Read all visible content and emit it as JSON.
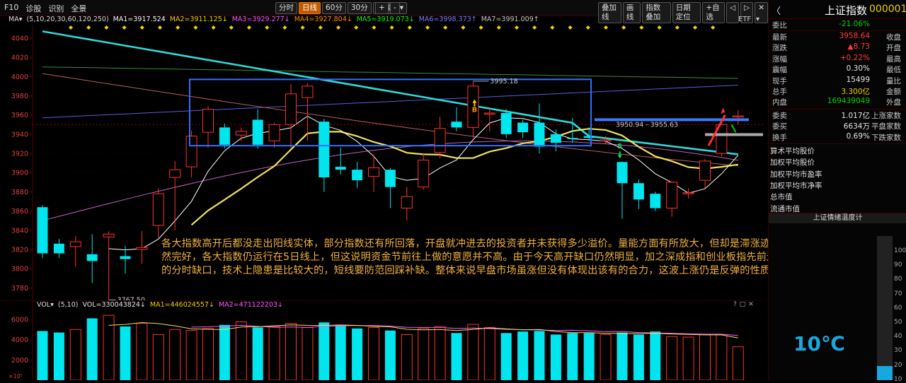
{
  "toolbar": {
    "left_items": [
      "F10",
      "诊股",
      "识别",
      "全景"
    ],
    "periods": [
      "分时",
      "日线",
      "60分",
      "30分",
      "周线"
    ],
    "active_period": "日线",
    "period_more": "▾",
    "plus": "+",
    "minus": "-",
    "right_items": [
      "叠加线",
      "画线",
      "指数叠加",
      "日期定位",
      "+自选"
    ],
    "window_icons": [
      "◁",
      "▷",
      "✕"
    ]
  },
  "ma_legend": {
    "label": "MA▾",
    "params": "(5,10,20,30,60,120,250)",
    "items": [
      {
        "text": "MA1=3917.524",
        "color": "#ffffff"
      },
      {
        "text": "MA2=3911.125↓",
        "color": "#f0d000"
      },
      {
        "text": "MA3=3929.277↓",
        "color": "#ff55ff"
      },
      {
        "text": "MA4=3927.804↓",
        "color": "#ff8c00"
      },
      {
        "text": "MA5=3919.073↓",
        "color": "#00ff00"
      },
      {
        "text": "MA6=3998.373↑",
        "color": "#7b7bff"
      },
      {
        "text": "MA7=3991.009↑",
        "color": "#c8c8c8"
      }
    ],
    "etf": "ETF",
    "etf_arrow": "▾"
  },
  "main_axis": {
    "ticks": [
      "4040",
      "4020",
      "4000",
      "3980",
      "3960",
      "3940",
      "3920",
      "3900",
      "3880",
      "3860",
      "3840",
      "3820",
      "3800",
      "3780"
    ]
  },
  "annotations": {
    "high_price": "3995.18",
    "low_price": "3767.50",
    "gap_range": "3950.94 - 3955.63",
    "buy_marker": "B",
    "sell_marker": "S"
  },
  "note_text": "各大指数高开后都没走出阳线实体，部分指数还有所回落，开盘就冲进去的投资者并未获得多少溢价。量能方面有所放大，但却是滞涨迹象。虽然反弹趋势仍然完好，各大指数仍运行在5日线上，但这说明资金节前往上做的意愿并不高。由于今天高开缺口仍然明显，加之深成指和创业板指先前还有留有两个未补完的分时缺口，技术上隐患是比较大的，短线要防范回踩补缺。整体来说早盘市场虽涨但没有体现出该有的合力，这波上涨仍是反弹的性质不变。",
  "vol_legend": {
    "label": "VOL▾",
    "params": "(5,10)",
    "items": [
      {
        "text": "VOL=330043824↓",
        "color": "#e6e6e6"
      },
      {
        "text": "MA1=446024557↓",
        "color": "#f0d000"
      },
      {
        "text": "MA2=471122203↓",
        "color": "#ff55ff"
      }
    ],
    "axis": [
      "6000",
      "4000",
      "2000"
    ],
    "unit": "×10⁵",
    "icons": [
      "?",
      "□",
      "✕"
    ]
  },
  "chart_data": {
    "type": "candlestick",
    "y_range": [
      3770,
      4048
    ],
    "candles": [
      {
        "o": 3864,
        "c": 3816,
        "h": 3866,
        "l": 3811
      },
      {
        "o": 3826,
        "c": 3816,
        "h": 3831,
        "l": 3811
      },
      {
        "o": 3823,
        "c": 3828,
        "h": 3834,
        "l": 3802
      },
      {
        "o": 3815,
        "c": 3808,
        "h": 3836,
        "l": 3785
      },
      {
        "o": 3833,
        "c": 3836,
        "h": 3839,
        "l": 3767.5
      },
      {
        "o": 3813,
        "c": 3810,
        "h": 3824,
        "l": 3795
      },
      {
        "o": 3820,
        "c": 3822,
        "h": 3839,
        "l": 3805
      },
      {
        "o": 3845,
        "c": 3878,
        "h": 3884,
        "l": 3832
      },
      {
        "o": 3895,
        "c": 3903,
        "h": 3912,
        "l": 3840
      },
      {
        "o": 3906,
        "c": 3938,
        "h": 3944,
        "l": 3895
      },
      {
        "o": 3942,
        "c": 3966,
        "h": 3969,
        "l": 3926
      },
      {
        "o": 3947,
        "c": 3929,
        "h": 3951,
        "l": 3925
      },
      {
        "o": 3939,
        "c": 3943,
        "h": 3947,
        "l": 3933
      },
      {
        "o": 3955,
        "c": 3929,
        "h": 3966,
        "l": 3925
      },
      {
        "o": 3933,
        "c": 3950,
        "h": 3952,
        "l": 3926
      },
      {
        "o": 3950,
        "c": 3982,
        "h": 3992,
        "l": 3925
      },
      {
        "o": 3978,
        "c": 3990,
        "h": 3993,
        "l": 3933
      },
      {
        "o": 3953,
        "c": 3895,
        "h": 3956,
        "l": 3880
      },
      {
        "o": 3906,
        "c": 3903,
        "h": 3926,
        "l": 3898
      },
      {
        "o": 3903,
        "c": 3892,
        "h": 3911,
        "l": 3884
      },
      {
        "o": 3896,
        "c": 3905,
        "h": 3918,
        "l": 3880
      },
      {
        "o": 3903,
        "c": 3885,
        "h": 3905,
        "l": 3863
      },
      {
        "o": 3863,
        "c": 3875,
        "h": 3885,
        "l": 3850
      },
      {
        "o": 3885,
        "c": 3913,
        "h": 3920,
        "l": 3882
      },
      {
        "o": 3921,
        "c": 3946,
        "h": 3958,
        "l": 3915
      },
      {
        "o": 3953,
        "c": 3947,
        "h": 3968,
        "l": 3943
      },
      {
        "o": 3947,
        "c": 3990,
        "h": 3995.18,
        "l": 3936
      },
      {
        "o": 3962,
        "c": 3962,
        "h": 3968,
        "l": 3943
      },
      {
        "o": 3962,
        "c": 3940,
        "h": 3966,
        "l": 3936
      },
      {
        "o": 3952,
        "c": 3942,
        "h": 3955,
        "l": 3936
      },
      {
        "o": 3952,
        "c": 3927,
        "h": 3972,
        "l": 3920
      },
      {
        "o": 3940,
        "c": 3931,
        "h": 3945,
        "l": 3922
      },
      {
        "o": 3936,
        "c": 3935,
        "h": 3957,
        "l": 3931
      },
      {
        "o": 3938,
        "c": 3936,
        "h": 3947,
        "l": 3933
      },
      {
        "o": 3934,
        "c": 3934,
        "h": 3938,
        "l": 3930
      },
      {
        "o": 3911,
        "c": 3889,
        "h": 3912,
        "l": 3852
      },
      {
        "o": 3889,
        "c": 3872,
        "h": 3893,
        "l": 3862
      },
      {
        "o": 3878,
        "c": 3863,
        "h": 3880,
        "l": 3860
      },
      {
        "o": 3863,
        "c": 3890,
        "h": 3891,
        "l": 3854
      },
      {
        "o": 3878,
        "c": 3879,
        "h": 3884,
        "l": 3873
      },
      {
        "o": 3892,
        "c": 3912,
        "h": 3914,
        "l": 3884
      },
      {
        "o": 3920,
        "c": 3950,
        "h": 3951,
        "l": 3917
      },
      {
        "o": 3958,
        "c": 3959,
        "h": 3965,
        "l": 3950
      }
    ],
    "volumes": [
      4850,
      4700,
      5000,
      6100,
      6400,
      5300,
      5600,
      4500,
      5000,
      4900,
      5100,
      5450,
      5750,
      5200,
      5300,
      5600,
      5200,
      5700,
      5400,
      5100,
      5200,
      4900,
      4500,
      5100,
      5300,
      4650,
      5500,
      5200,
      4650,
      4800,
      4850,
      4500,
      4650,
      4650,
      4500,
      4700,
      4500,
      4800,
      4300,
      4250,
      4500,
      4500,
      3300
    ]
  },
  "right_panel": {
    "back_icon": "〈",
    "title": "上证指数",
    "code": "000001",
    "webi": {
      "label": "委比",
      "value": "-21.06%"
    },
    "rows": [
      {
        "k": "最新",
        "v": "3958.64",
        "vc": "red",
        "k2": "收盘"
      },
      {
        "k": "涨跌",
        "v": "▲8.73",
        "vc": "red",
        "k2": "开盘"
      },
      {
        "k": "涨幅",
        "v": "+0.22%",
        "vc": "red",
        "k2": "最高"
      },
      {
        "k": "震幅",
        "v": "0.30%",
        "vc": "white",
        "k2": "最低"
      },
      {
        "k": "现手",
        "v": "15499",
        "vc": "white",
        "k2": "量比"
      },
      {
        "k": "总手",
        "v": "3.300亿",
        "vc": "yellow",
        "k2": "金额"
      },
      {
        "k": "内盘",
        "v": "169439049",
        "vc": "green",
        "k2": "外盘"
      }
    ],
    "rows2": [
      {
        "k": "委卖",
        "v": "1.017亿",
        "vc": "white",
        "k2": "上涨家数"
      },
      {
        "k": "委买",
        "v": "6634万",
        "vc": "white",
        "k2": "平盘家数"
      },
      {
        "k": "换手",
        "v": "0.69%",
        "vc": "white",
        "k2": "下跌家数"
      }
    ],
    "list": [
      "算术平均股价",
      "加权平均股价",
      "加权平均市盈率",
      "加权平均市净率",
      "总市值",
      "流通市值"
    ],
    "temp_title": "上证情绪温度计",
    "temperature": "10℃",
    "temp_axis": [
      "100",
      "90",
      "80",
      "70",
      "60",
      "50",
      "40",
      "30",
      "20",
      "10"
    ],
    "temp_level": 0.1
  }
}
